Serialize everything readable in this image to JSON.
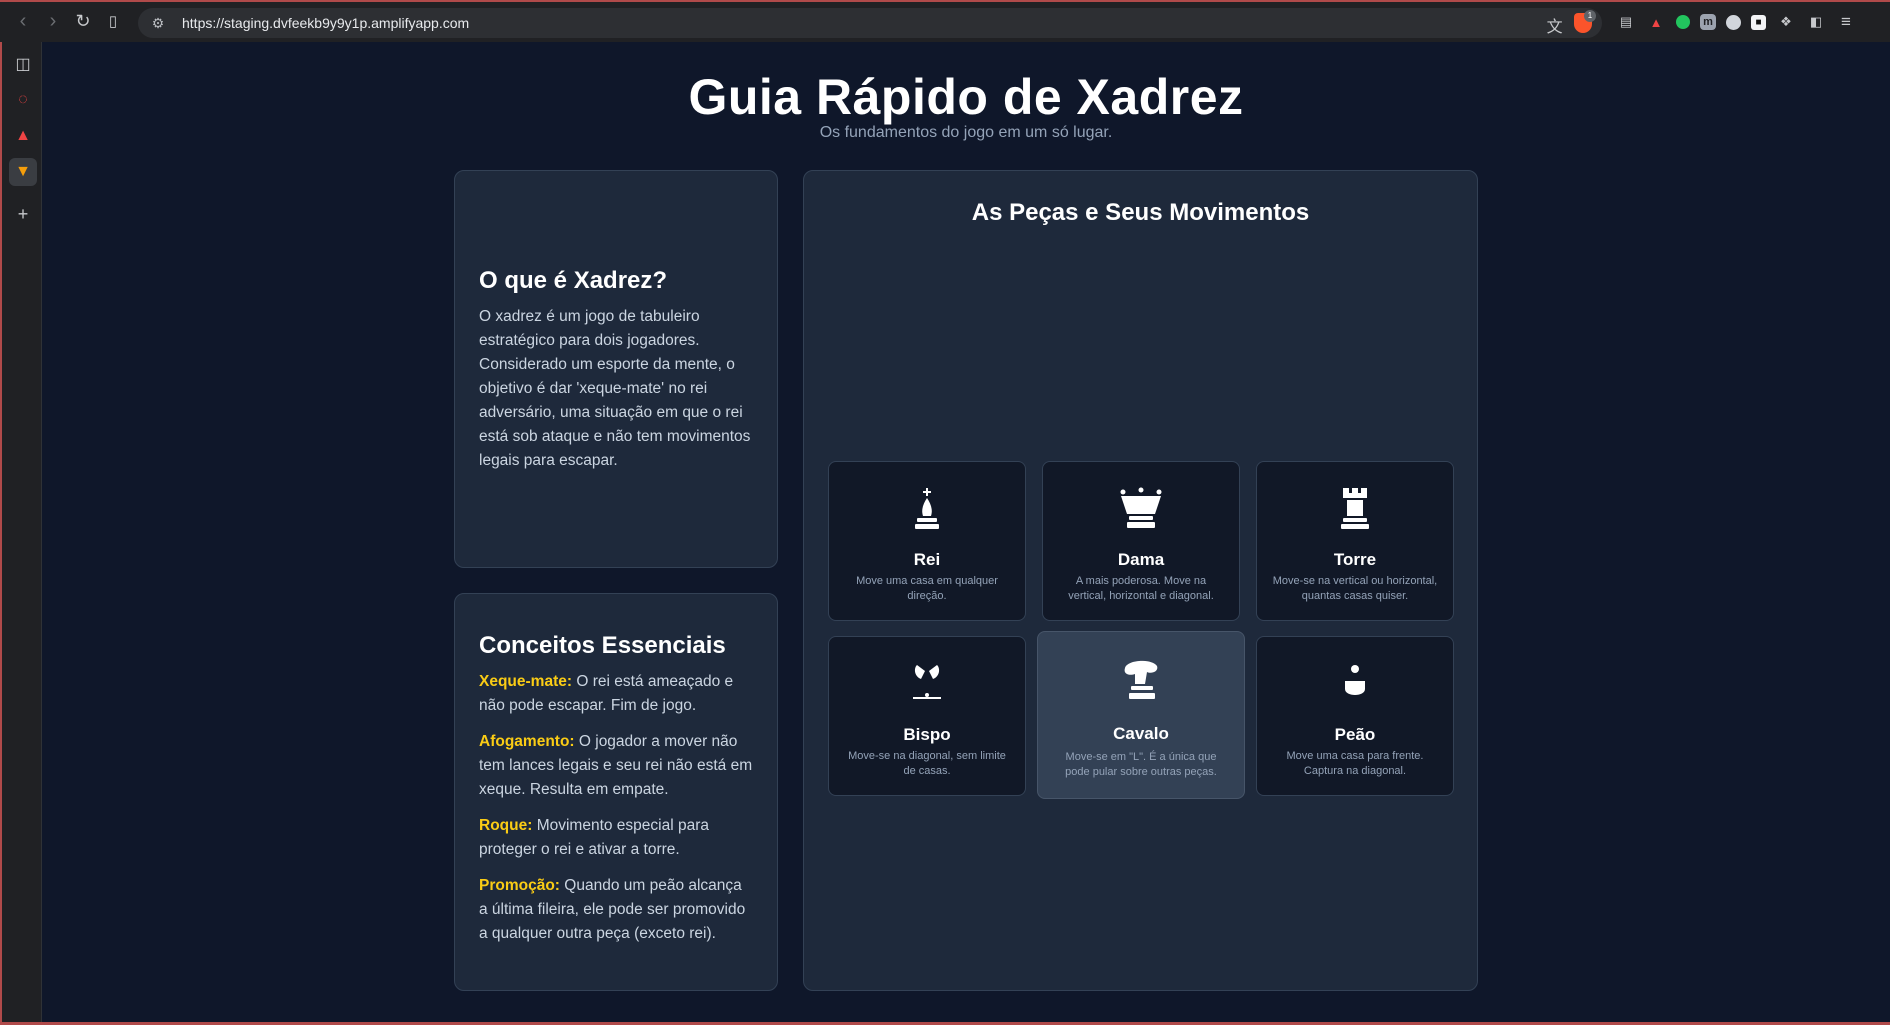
{
  "browser": {
    "url": "https://staging.dvfeekb9y9y1p.amplifyapp.com",
    "brave_badge": "1"
  },
  "icons": {
    "back": "back-arrow-icon",
    "forward": "forward-arrow-icon",
    "reload": "reload-icon",
    "bookmark": "bookmark-icon",
    "site_info": "site-settings-icon",
    "translate": "translate-icon",
    "share": "share-icon",
    "brave": "brave-shield-icon",
    "menu": "hamburger-menu-icon"
  },
  "header": {
    "title": "Guia Rápido de Xadrez",
    "subtitle": "Os fundamentos do jogo em um só lugar."
  },
  "intro": {
    "heading": "O que é Xadrez?",
    "text": "O xadrez é um jogo de tabuleiro estratégico para dois jogadores. Considerado um esporte da mente, o objetivo é dar 'xeque-mate' no rei adversário, uma situação em que o rei está sob ataque e não tem movimentos legais para escapar."
  },
  "concepts": {
    "heading": "Conceitos Essenciais",
    "items": [
      {
        "term": "Xeque-mate:",
        "text": " O rei está ameaçado e não pode escapar. Fim de jogo."
      },
      {
        "term": "Afogamento:",
        "text": " O jogador a mover não tem lances legais e seu rei não está em xeque. Resulta em empate."
      },
      {
        "term": "Roque:",
        "text": " Movimento especial para proteger o rei e ativar a torre."
      },
      {
        "term": "Promoção:",
        "text": " Quando um peão alcança a última fileira, ele pode ser promovido a qualquer outra peça (exceto rei)."
      }
    ]
  },
  "pieces": {
    "heading": "As Peças e Seus Movimentos",
    "items": [
      {
        "name": "Rei",
        "desc": "Move uma casa em qualquer direção.",
        "icon": "king-icon"
      },
      {
        "name": "Dama",
        "desc": "A mais poderosa. Move na vertical, horizontal e diagonal.",
        "icon": "queen-icon"
      },
      {
        "name": "Torre",
        "desc": "Move-se na vertical ou horizontal, quantas casas quiser.",
        "icon": "rook-icon"
      },
      {
        "name": "Bispo",
        "desc": "Move-se na diagonal, sem limite de casas.",
        "icon": "bishop-icon"
      },
      {
        "name": "Cavalo",
        "desc": "Move-se em \"L\". É a única que pode pular sobre outras peças.",
        "icon": "knight-icon"
      },
      {
        "name": "Peão",
        "desc": "Move uma casa para frente. Captura na diagonal.",
        "icon": "pawn-icon"
      }
    ]
  },
  "colors": {
    "background": "#0f172a",
    "card": "#1e293b",
    "accent": "#facc15"
  }
}
